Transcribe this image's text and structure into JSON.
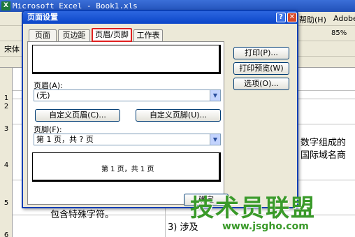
{
  "excel": {
    "window_title": "Microsoft Excel - Book1.xls",
    "menu_help": "帮助(H)",
    "menu_adobe": "Adobe",
    "zoom": "85%",
    "font_name": "宋体",
    "row_numbers": [
      "1",
      "2",
      "3",
      "4",
      "5",
      "6"
    ],
    "cells": {
      "c3_right": "数字组成的",
      "c3b_right": "国际域名商",
      "c5_left": "包含特殊字符。",
      "c6_right": "3) 涉及"
    }
  },
  "dialog": {
    "title": "页面设置",
    "help_glyph": "?",
    "close_glyph": "✕",
    "tabs": [
      "页面",
      "页边距",
      "页眉/页脚",
      "工作表"
    ],
    "active_tab": "页眉/页脚",
    "header_label": "页眉(A):",
    "header_value": "(无)",
    "footer_label": "页脚(F):",
    "footer_value": "第 1 页，共 ? 页",
    "custom_header_button": "自定义页眉(C)...",
    "custom_footer_button": "自定义页脚(U)...",
    "footer_preview_text": "第 1 页，共 1 页",
    "print_button": "打印(P)...",
    "print_preview_button": "打印预览(W)",
    "options_button": "选项(O)...",
    "ok_button": "确定"
  },
  "watermark": {
    "text": "技术员联盟",
    "url": "www.jsgho.com"
  }
}
